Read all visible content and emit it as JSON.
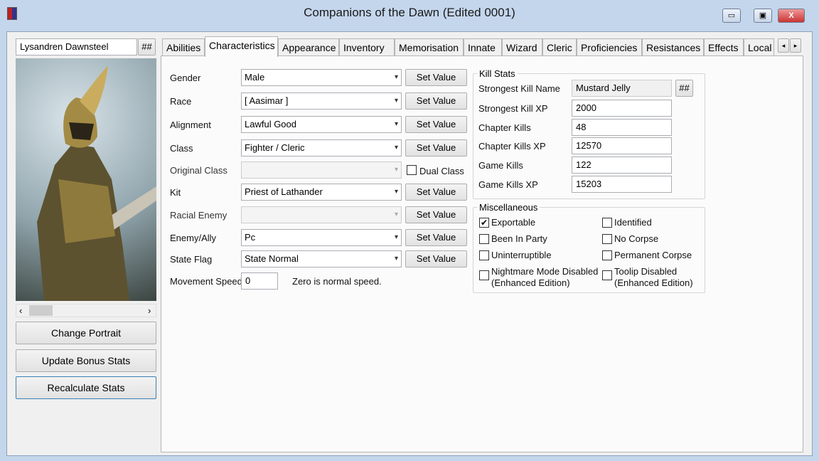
{
  "window": {
    "title": "Companions of the Dawn (Edited 0001)",
    "minimize": "▭",
    "maximize": "▣",
    "close": "X"
  },
  "left": {
    "name": "Lysandren Dawnsteel",
    "hash": "##",
    "scroll_left": "‹",
    "scroll_right": "›",
    "buttons": [
      "Change Portrait",
      "Update Bonus Stats",
      "Recalculate Stats"
    ]
  },
  "tabs": [
    "Abilities",
    "Characteristics",
    "Appearance",
    "Inventory",
    "Memorisation",
    "Innate",
    "Wizard",
    "Cleric",
    "Proficiencies",
    "Resistances",
    "Effects",
    "Local"
  ],
  "tab_active": "Characteristics",
  "tab_scroll": [
    "◂",
    "▸"
  ],
  "fields": [
    {
      "label": "Gender",
      "value": "Male",
      "button": "Set Value"
    },
    {
      "label": "Race",
      "value": "[ Aasimar ]",
      "button": "Set Value"
    },
    {
      "label": "Alignment",
      "value": "Lawful Good",
      "button": "Set Value"
    },
    {
      "label": "Class",
      "value": "Fighter / Cleric",
      "button": "Set Value"
    },
    {
      "label": "Original Class",
      "value": "",
      "disabled": true,
      "checkbox": "Dual Class"
    },
    {
      "label": "Kit",
      "value": "Priest of Lathander",
      "button": "Set Value"
    },
    {
      "label": "Racial Enemy",
      "value": "",
      "disabled": true,
      "button": "Set Value"
    },
    {
      "label": "Enemy/Ally",
      "value": "Pc",
      "button": "Set Value"
    },
    {
      "label": "State Flag",
      "value": "State Normal",
      "button": "Set Value"
    }
  ],
  "movement": {
    "label": "Movement Speed",
    "value": "0",
    "hint": "Zero is normal speed."
  },
  "kill_stats": {
    "title": "Kill Stats",
    "hash": "##",
    "rows": [
      {
        "label": "Strongest Kill Name",
        "value": "Mustard Jelly",
        "readonly": true
      },
      {
        "label": "Strongest Kill XP",
        "value": "2000"
      },
      {
        "label": "Chapter Kills",
        "value": "48"
      },
      {
        "label": "Chapter Kills XP",
        "value": "12570"
      },
      {
        "label": "Game Kills",
        "value": "122"
      },
      {
        "label": "Game Kills XP",
        "value": "15203"
      }
    ]
  },
  "misc": {
    "title": "Miscellaneous",
    "items": [
      {
        "label": "Exportable",
        "checked": true
      },
      {
        "label": "Identified",
        "checked": false
      },
      {
        "label": "Been In Party",
        "checked": false
      },
      {
        "label": "No Corpse",
        "checked": false
      },
      {
        "label": "Uninterruptible",
        "checked": false
      },
      {
        "label": "Permanent Corpse",
        "checked": false
      },
      {
        "label": "Nightmare Mode Disabled",
        "label2": "(Enhanced Edition)",
        "checked": false
      },
      {
        "label": "Toolip Disabled",
        "label2": "(Enhanced Edition)",
        "checked": false
      }
    ]
  }
}
